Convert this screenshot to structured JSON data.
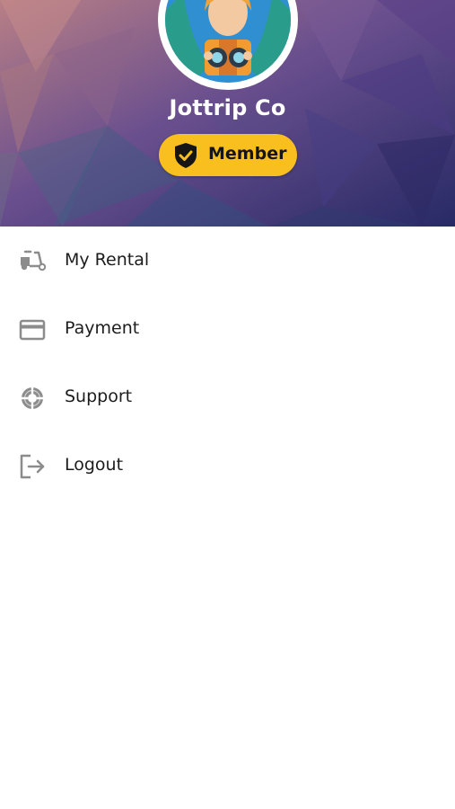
{
  "profile": {
    "name": "Jottrip Co",
    "badge_label": "Member",
    "avatar_icon": "traveler-avatar",
    "badge_icon": "shield-check-icon",
    "badge_color": "#f9bf1f"
  },
  "menu": {
    "items": [
      {
        "label": "My Rental",
        "icon": "scooter-icon"
      },
      {
        "label": "Payment",
        "icon": "credit-card-icon"
      },
      {
        "label": "Support",
        "icon": "lifebuoy-icon"
      },
      {
        "label": "Logout",
        "icon": "logout-icon"
      }
    ]
  },
  "colors": {
    "header_gradient": [
      "#b07a88",
      "#5b4a8a",
      "#3a2e7a",
      "#22285c"
    ],
    "icon_gray": "#8c8c8c",
    "text": "#1c1c1c"
  }
}
